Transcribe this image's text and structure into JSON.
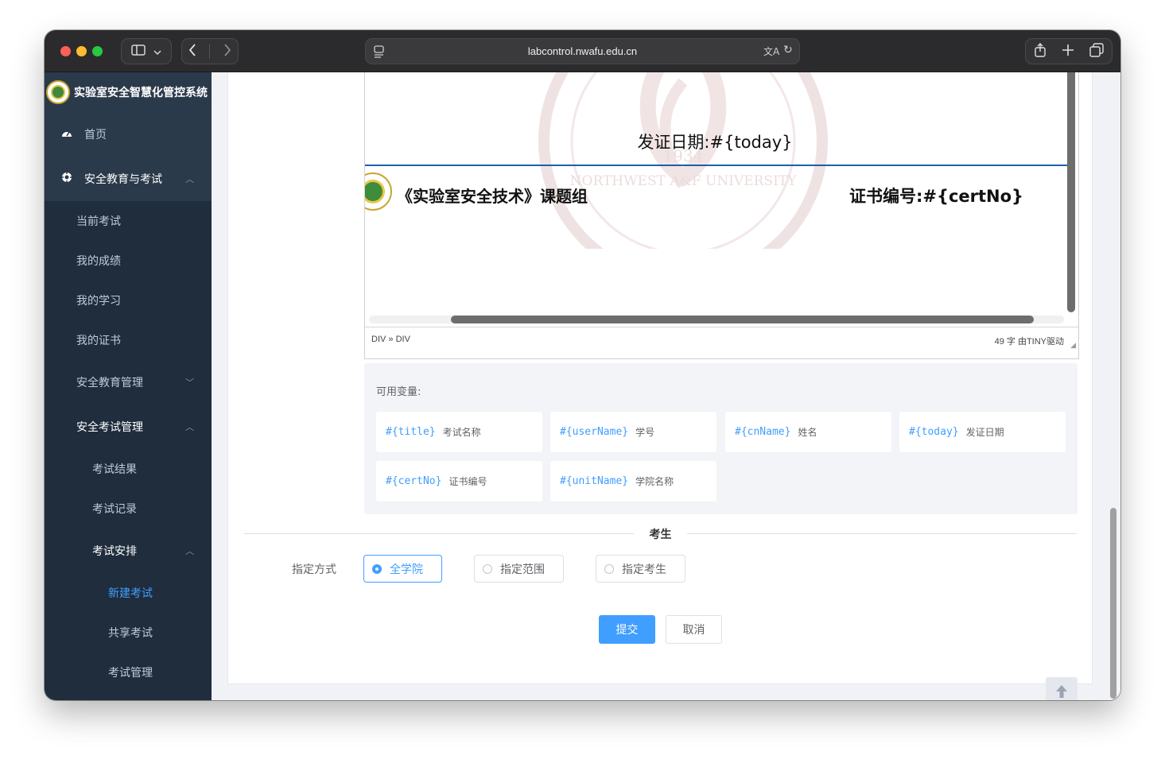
{
  "browser": {
    "url": "labcontrol.nwafu.edu.cn",
    "icons": [
      "sidebar-icon",
      "chevron-down-icon",
      "back-icon",
      "forward-icon",
      "page-icon",
      "translate-icon",
      "reload-icon",
      "share-icon",
      "new-tab-icon",
      "tabs-icon"
    ]
  },
  "app": {
    "title": "实验室安全智慧化管控系统"
  },
  "sidebar": {
    "home": "首页",
    "edu_exam": "安全教育与考试",
    "current_exam": "当前考试",
    "my_scores": "我的成绩",
    "my_study": "我的学习",
    "my_certs": "我的证书",
    "edu_mgmt": "安全教育管理",
    "exam_mgmt": "安全考试管理",
    "exam_results": "考试结果",
    "exam_records": "考试记录",
    "exam_schedule": "考试安排",
    "new_exam": "新建考试",
    "shared_exam": "共享考试",
    "exam_manage": "考试管理"
  },
  "editor": {
    "issue_date": "发证日期:#{today}",
    "group_name": "《实验室安全技术》课题组",
    "cert_no": "证书编号:#{certNo}",
    "path": "DIV » DIV",
    "word_count": "49 字 由TINY驱动",
    "watermark_year": "1934",
    "watermark_text": "NORTHWEST A&F UNIVERSITY"
  },
  "variables": {
    "title": "可用变量:",
    "items": [
      {
        "code": "#{title}",
        "desc": "考试名称"
      },
      {
        "code": "#{userName}",
        "desc": "学号"
      },
      {
        "code": "#{cnName}",
        "desc": "姓名"
      },
      {
        "code": "#{today}",
        "desc": "发证日期"
      },
      {
        "code": "#{certNo}",
        "desc": "证书编号"
      },
      {
        "code": "#{unitName}",
        "desc": "学院名称"
      }
    ]
  },
  "form": {
    "section": "考生",
    "assign_label": "指定方式",
    "options": [
      "全学院",
      "指定范围",
      "指定考生"
    ],
    "selected": "全学院",
    "submit": "提交",
    "cancel": "取消"
  },
  "colors": {
    "primary": "#409eff",
    "sidebar_bg": "#1f2d3d",
    "sidebar_active_bg": "#2b3a4b"
  }
}
